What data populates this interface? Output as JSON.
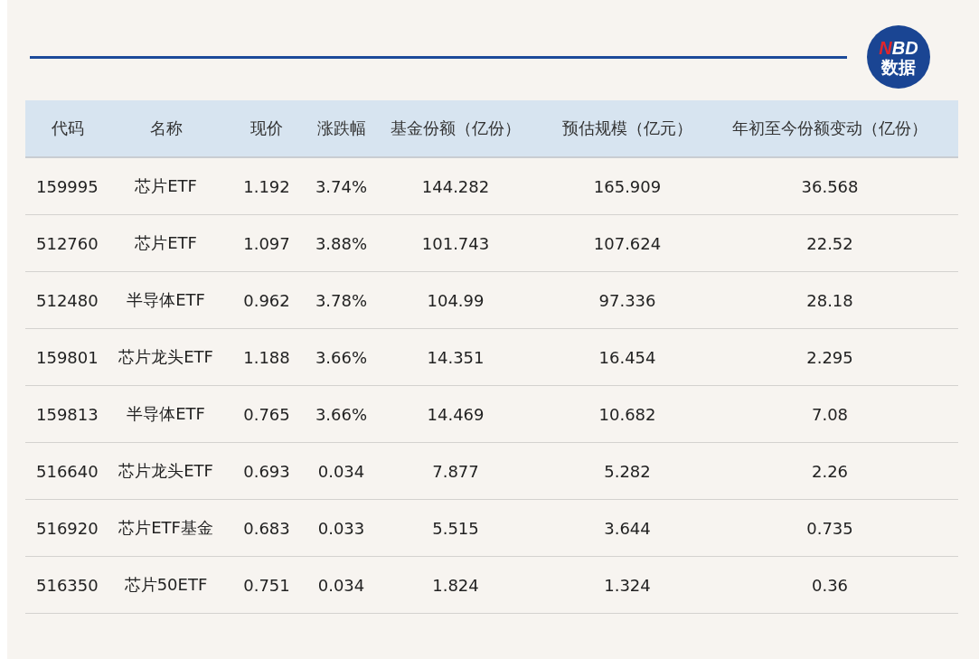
{
  "logo": {
    "brand": "NBD",
    "label": "数据"
  },
  "table": {
    "columns": [
      "代码",
      "名称",
      "现价",
      "涨跌幅",
      "基金份额（亿份）",
      "预估规模（亿元）",
      "年初至今份额变动（亿份）"
    ],
    "rows": [
      [
        "159995",
        "芯片ETF",
        "1.192",
        "3.74%",
        "144.282",
        "165.909",
        "36.568"
      ],
      [
        "512760",
        "芯片ETF",
        "1.097",
        "3.88%",
        "101.743",
        "107.624",
        "22.52"
      ],
      [
        "512480",
        "半导体ETF",
        "0.962",
        "3.78%",
        "104.99",
        "97.336",
        "28.18"
      ],
      [
        "159801",
        "芯片龙头ETF",
        "1.188",
        "3.66%",
        "14.351",
        "16.454",
        "2.295"
      ],
      [
        "159813",
        "半导体ETF",
        "0.765",
        "3.66%",
        "14.469",
        "10.682",
        "7.08"
      ],
      [
        "516640",
        "芯片龙头ETF",
        "0.693",
        "0.034",
        "7.877",
        "5.282",
        "2.26"
      ],
      [
        "516920",
        "芯片ETF基金",
        "0.683",
        "0.033",
        "5.515",
        "3.644",
        "0.735"
      ],
      [
        "516350",
        "芯片50ETF",
        "0.751",
        "0.034",
        "1.824",
        "1.324",
        "0.36"
      ]
    ]
  }
}
